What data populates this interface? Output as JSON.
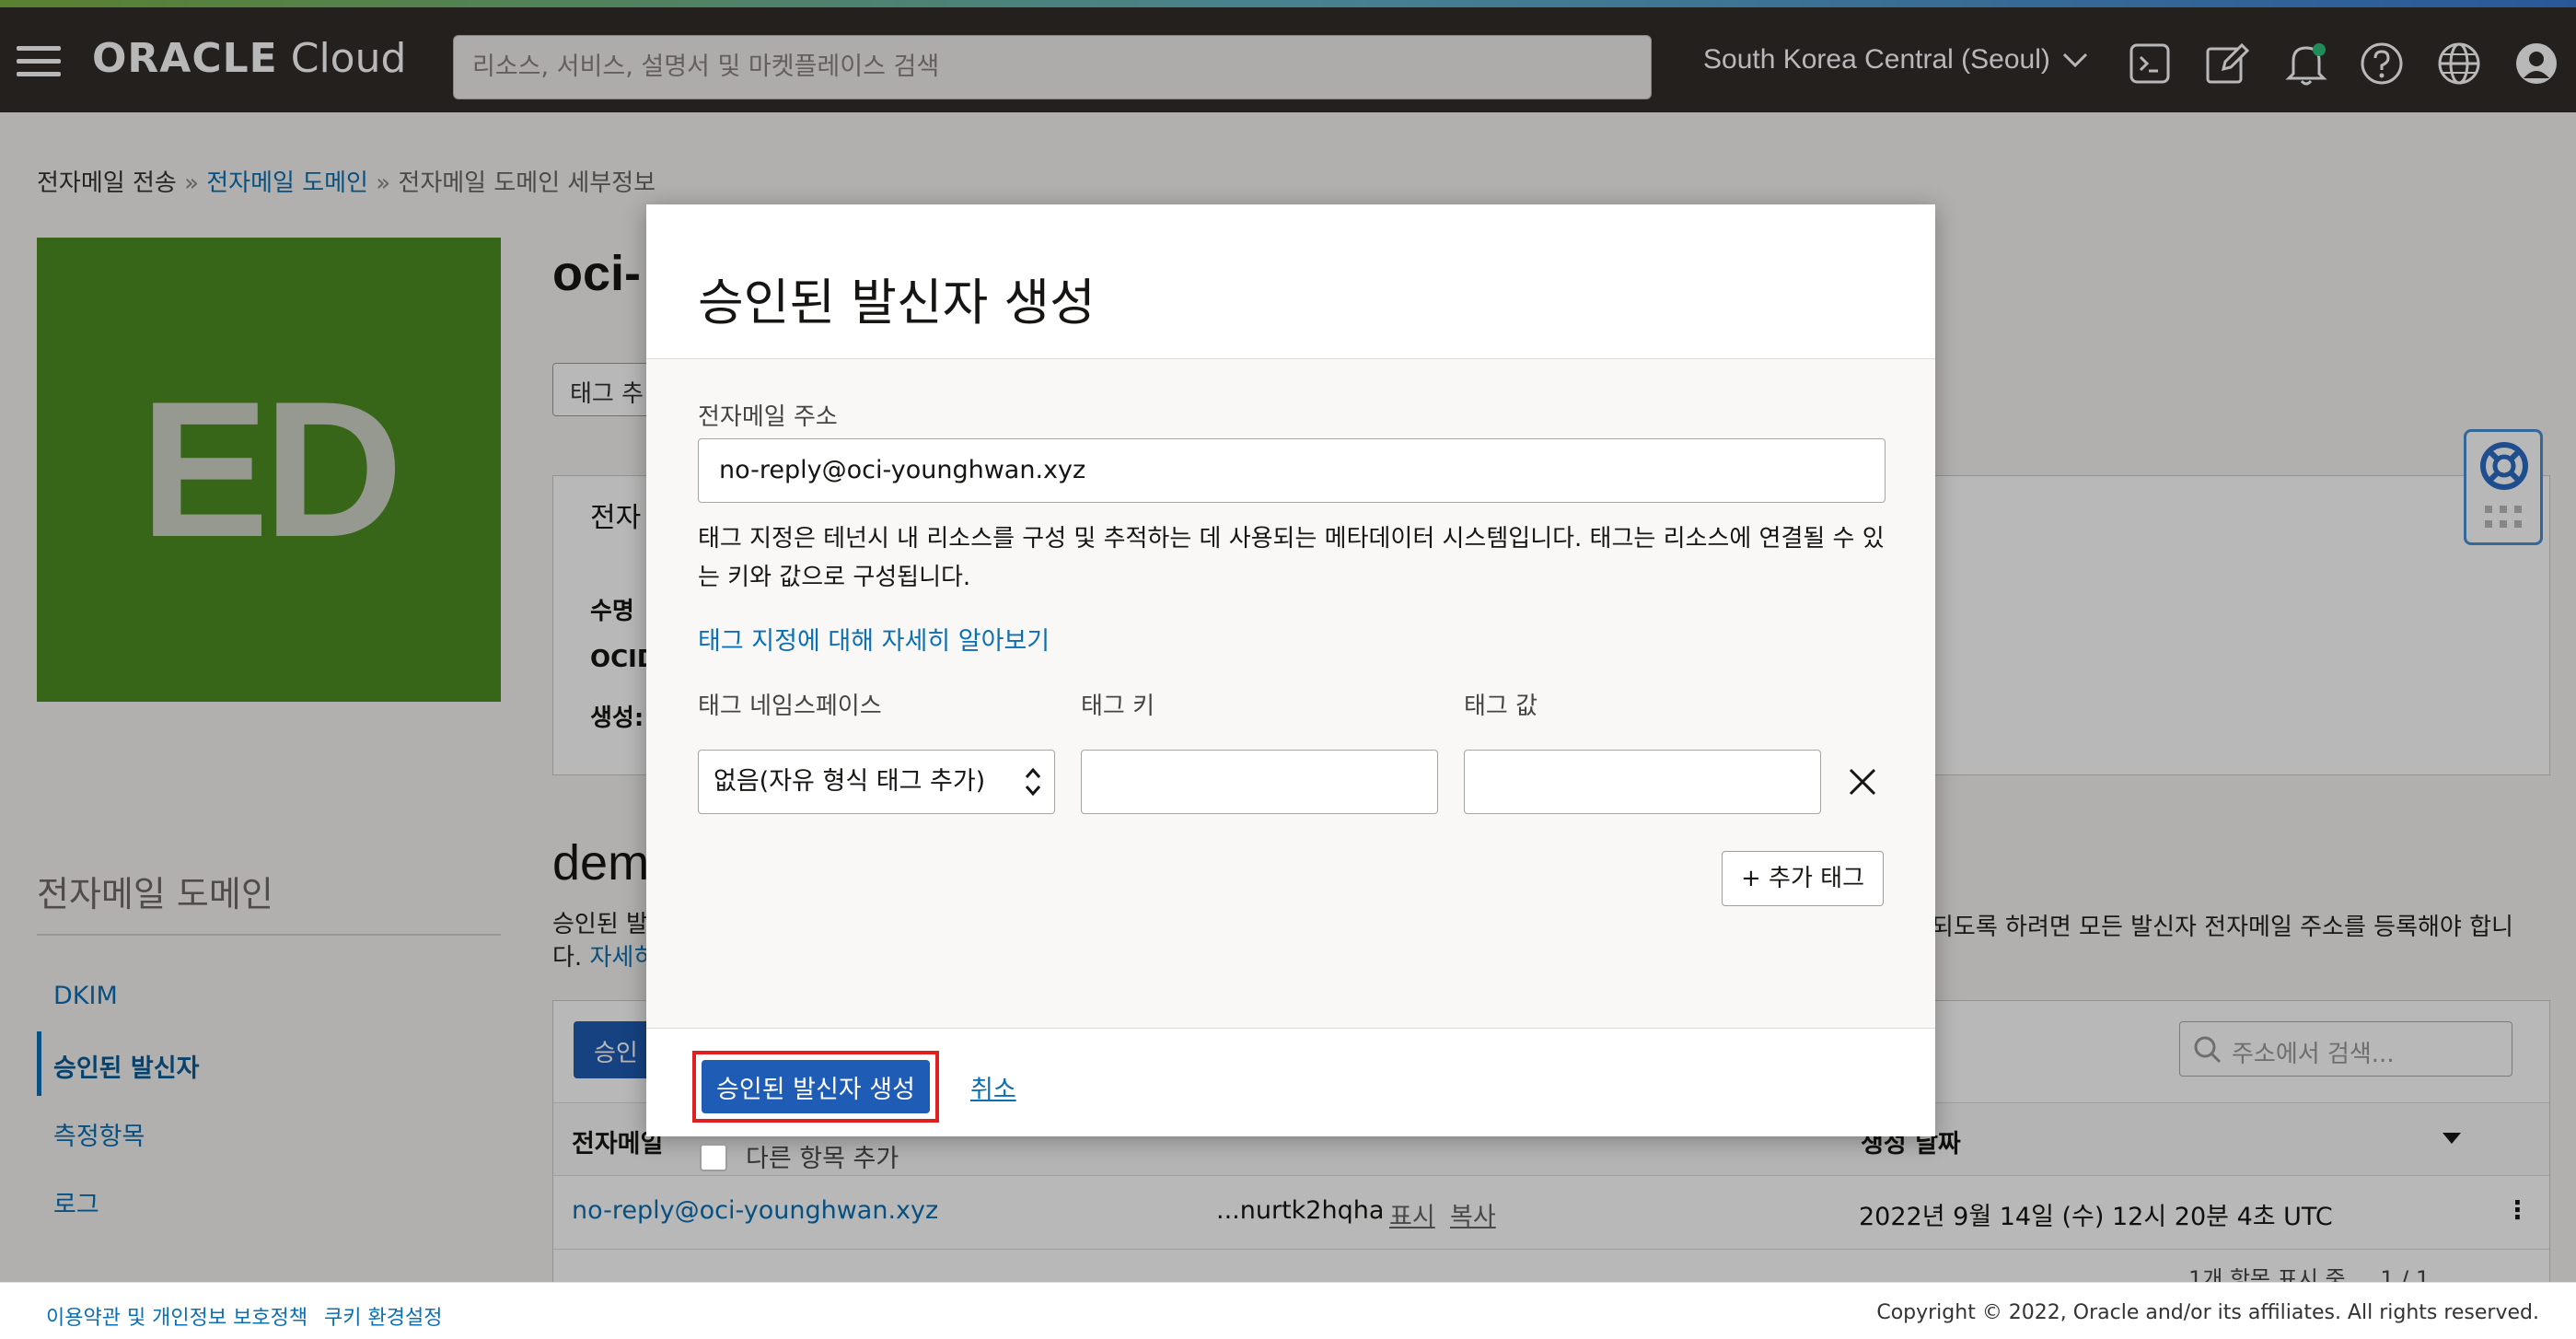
{
  "header": {
    "logo_oracle": "ORACLE",
    "logo_cloud": "Cloud",
    "search_placeholder": "리소스, 서비스, 설명서 및 마켓플레이스 검색",
    "region": "South Korea Central (Seoul)"
  },
  "breadcrumb": {
    "item1": "전자메일 전송",
    "sep": "»",
    "item2": "전자메일 도메인",
    "item3": "전자메일 도메인 세부정보"
  },
  "domain_tile": {
    "initials": "ED",
    "color": "#4d8e23"
  },
  "page": {
    "title_partial": "oci-",
    "tag_button_partial": "태그 추",
    "panel_title_partial": "전자",
    "row1_partial": "수명",
    "row2_partial": "OCID",
    "row3_partial": "생성:"
  },
  "sidebar": {
    "title": "전자메일 도메인",
    "items": [
      {
        "label": "DKIM"
      },
      {
        "label": "승인된 발신자"
      },
      {
        "label": "측정항목"
      },
      {
        "label": "로그"
      }
    ]
  },
  "section": {
    "title_partial": "dem",
    "desc_line1_partial": "승인된 발",
    "desc_line2_prefix": "다. ",
    "desc_link_partial": "자세히",
    "desc_right": "되도록 하려면 모든 발신자 전자메일 주소를 등록해야 합니",
    "table_search_placeholder": "주소에서 검색...",
    "table_button_partial": "승인",
    "col1": "전자메일",
    "col3": "생성 날짜",
    "row": {
      "email": "no-reply@oci-younghwan.xyz",
      "ocid": "...nurtk2hqha",
      "show": "표시",
      "copy": "복사",
      "created": "2022년 9월 14일 (수) 12시 20분 4초 UTC"
    },
    "pagination_partial": "1개 항목 표시 중",
    "pager": "1 / 1"
  },
  "modal": {
    "title": "승인된 발신자 생성",
    "email_label": "전자메일 주소",
    "email_value": "no-reply@oci-younghwan.xyz",
    "help_text": "태그 지정은 테넌시 내 리소스를 구성 및 추적하는 데 사용되는 메타데이터 시스템입니다. 태그는 리소스에 연결될 수 있는 키와 값으로 구성됩니다.",
    "learn_link": "태그 지정에 대해 자세히 알아보기",
    "ns_label": "태그 네임스페이스",
    "key_label": "태그 키",
    "value_label": "태그 값",
    "ns_selected": "없음(자유 형식 태그 추가)",
    "add_tag": "+ 추가 태그",
    "add_another": "다른 항목 추가",
    "create_button": "승인된 발신자 생성",
    "cancel": "취소"
  },
  "footer": {
    "terms": "이용약관 및 개인정보 보호정책",
    "cookies": "쿠키 환경설정",
    "copyright": "Copyright © 2022, Oracle and/or its affiliates. All rights reserved."
  },
  "colors": {
    "header_bg": "#312d2a",
    "link": "#0b6fb3",
    "primary": "#1f5cb5",
    "highlight": "#e02020"
  }
}
